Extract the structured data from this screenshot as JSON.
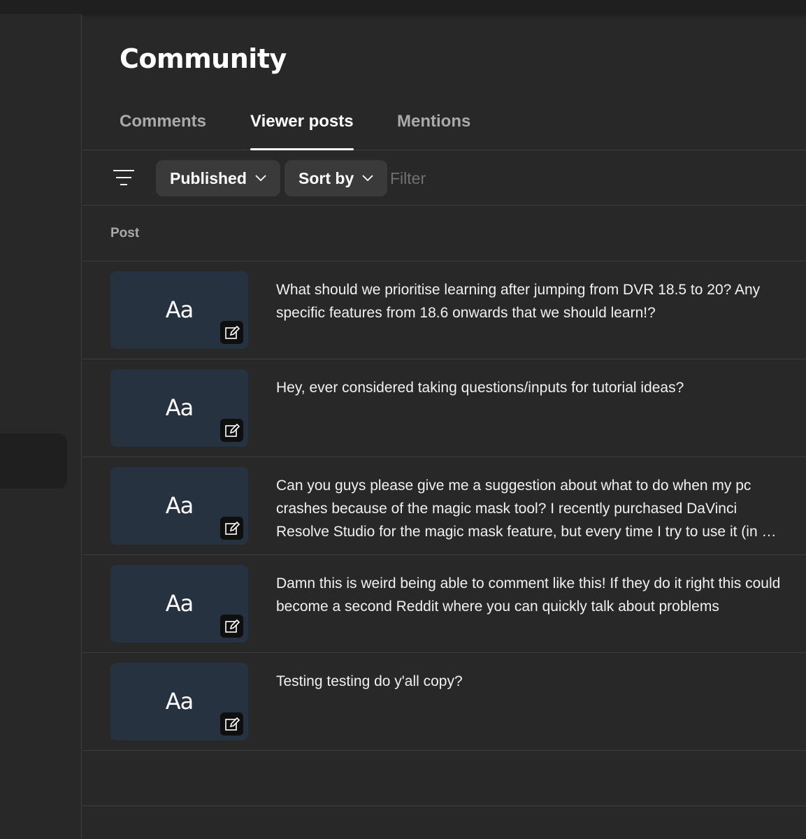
{
  "page": {
    "title": "Community"
  },
  "tabs": [
    {
      "label": "Comments",
      "active": false
    },
    {
      "label": "Viewer posts",
      "active": true
    },
    {
      "label": "Mentions",
      "active": false
    }
  ],
  "filter_bar": {
    "icon": "filter-lines-icon",
    "published_label": "Published",
    "sort_label": "Sort by",
    "filter_placeholder": "Filter"
  },
  "table": {
    "column_post": "Post"
  },
  "posts": [
    {
      "thumb_text": "Aa",
      "text": "What should we prioritise learning after jumping from DVR 18.5 to 20? Any specific features from 18.6 onwards that we should learn!?"
    },
    {
      "thumb_text": "Aa",
      "text": "Hey, ever considered taking questions/inputs for tutorial ideas?"
    },
    {
      "thumb_text": "Aa",
      "text": "Can you guys please give me a suggestion about what to do when my pc crashes because of the magic mask tool? I recently purchased DaVinci Resolve Studio for the magic mask feature, but every time I try to use it (in my project)"
    },
    {
      "thumb_text": "Aa",
      "text": "Damn this is weird being able to comment like this! If they do it right this could become a second Reddit where you can quickly talk about problems"
    },
    {
      "thumb_text": "Aa",
      "text": "Testing testing do y'all copy?"
    }
  ],
  "colors": {
    "background": "#282828",
    "thumb": "#263240",
    "chip": "#3a3a3a",
    "divider": "#3e3e3e"
  }
}
